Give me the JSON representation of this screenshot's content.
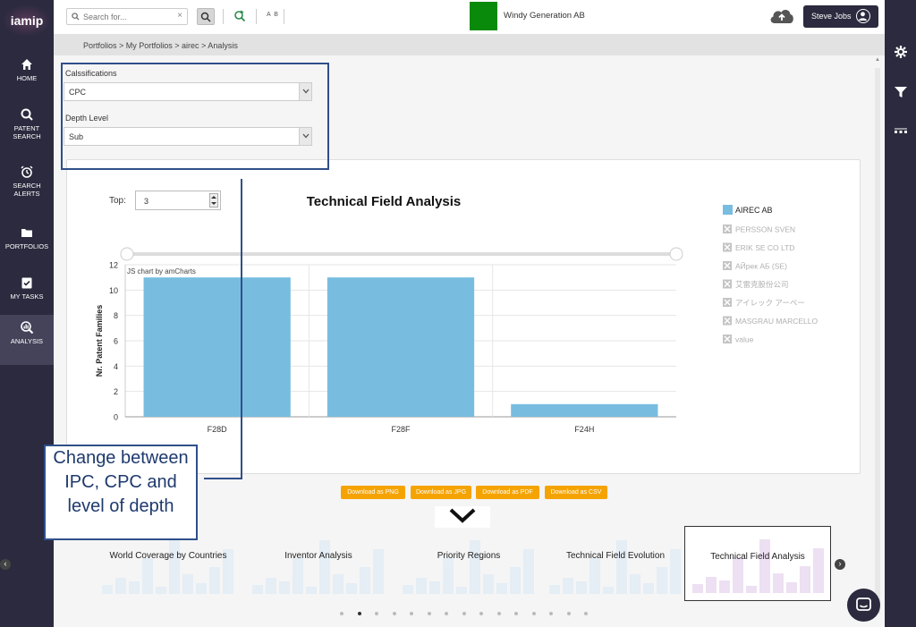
{
  "app": {
    "logo": "iamip"
  },
  "nav": [
    {
      "label": "HOME",
      "icon": "home-icon"
    },
    {
      "label": "PATENT SEARCH",
      "icon": "search-icon"
    },
    {
      "label": "SEARCH ALERTS",
      "icon": "alarm-icon"
    },
    {
      "label": "PORTFOLIOS",
      "icon": "folder-icon"
    },
    {
      "label": "MY TASKS",
      "icon": "tasks-icon"
    },
    {
      "label": "ANALYSIS",
      "icon": "analysis-icon",
      "active": true
    }
  ],
  "right_tools": [
    "settings-icon",
    "filter-icon",
    "more-icon"
  ],
  "topbar": {
    "search_placeholder": "Search for...",
    "search_clear": "×",
    "ab_label": "A B",
    "company": "Windy Generation AB",
    "company_color": "#0a8a0a",
    "user": "Steve Jobs"
  },
  "breadcrumb": "Portfolios > My Portfolios > airec > Analysis",
  "filters": {
    "classification_label": "Calssifications",
    "classification_value": "CPC",
    "depth_label": "Depth Level",
    "depth_value": "Sub"
  },
  "top": {
    "label": "Top:",
    "value": "3"
  },
  "chart_data": {
    "type": "bar",
    "title": "Technical Field Analysis",
    "credit": "JS chart by amCharts",
    "ylabel": "Nr. Patent Families",
    "xlabel": "",
    "categories": [
      "F28D",
      "F28F",
      "F24H"
    ],
    "series": [
      {
        "name": "AIREC AB",
        "values": [
          11,
          11,
          1
        ],
        "color": "#78bde0"
      }
    ],
    "ylim": [
      0,
      12
    ],
    "yticks": [
      0,
      2,
      4,
      6,
      8,
      10,
      12
    ],
    "legend_hidden": [
      "PERSSON SVEN",
      "ERIK SE CO LTD",
      "AЙрек АБ (SE)",
      "艾雷克股份公司",
      "アイレック アーベー",
      "MASGRAU MARCELLO",
      "value"
    ],
    "legend_position": "right",
    "grid": true
  },
  "downloads": [
    "Download as PNG",
    "Download as JPG",
    "Download as PDF",
    "Download as CSV"
  ],
  "carousel": {
    "items": [
      "World Coverage by Countries",
      "Inventor Analysis",
      "Priority Regions",
      "Technical Field Evolution",
      "Technical Field Analysis"
    ],
    "active_index": 4,
    "dots": 15,
    "active_dot": 1
  },
  "annotation": {
    "text": "Change between IPC, CPC and level of depth"
  }
}
